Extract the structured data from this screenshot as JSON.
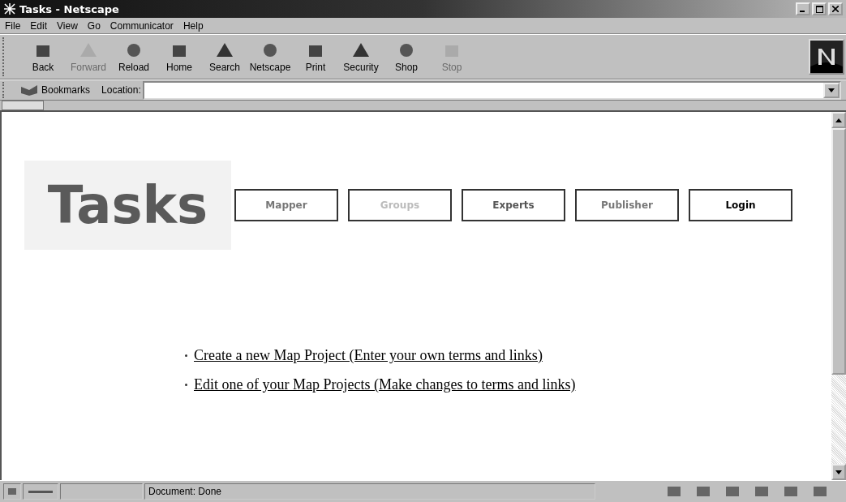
{
  "window": {
    "title": "Tasks - Netscape"
  },
  "menu": [
    "File",
    "Edit",
    "View",
    "Go",
    "Communicator",
    "Help"
  ],
  "toolbar": [
    {
      "label": "Back",
      "disabled": false
    },
    {
      "label": "Forward",
      "disabled": true
    },
    {
      "label": "Reload",
      "disabled": false
    },
    {
      "label": "Home",
      "disabled": false
    },
    {
      "label": "Search",
      "disabled": false
    },
    {
      "label": "Netscape",
      "disabled": false
    },
    {
      "label": "Print",
      "disabled": false
    },
    {
      "label": "Security",
      "disabled": false
    },
    {
      "label": "Shop",
      "disabled": false
    },
    {
      "label": "Stop",
      "disabled": true
    }
  ],
  "location_bar": {
    "bookmarks": "Bookmarks",
    "label": "Location:"
  },
  "page": {
    "logo": "Tasks",
    "nav": [
      {
        "label": "Mapper",
        "color": "#777777"
      },
      {
        "label": "Groups",
        "color": "#bbbbbb"
      },
      {
        "label": "Experts",
        "color": "#555555"
      },
      {
        "label": "Publisher",
        "color": "#777777"
      },
      {
        "label": "Login",
        "color": "#000000"
      }
    ],
    "links": [
      "Create a new Map Project (Enter your own terms and links)",
      "Edit one of your Map Projects (Make changes to terms and links)"
    ]
  },
  "status_bar": {
    "text": "Document: Done"
  }
}
